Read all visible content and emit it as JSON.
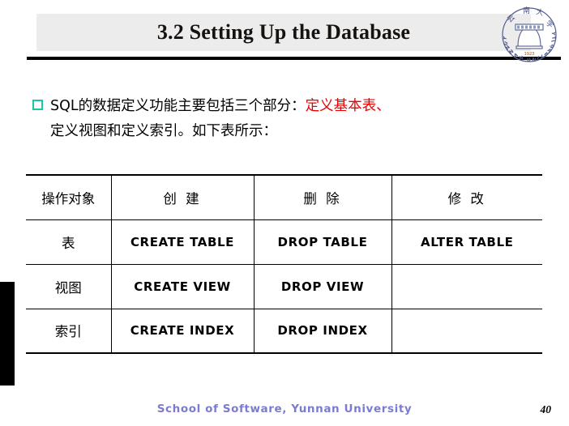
{
  "slide": {
    "title": "3.2 Setting Up the Database",
    "page_number": "40",
    "footer": "School of Software, Yunnan University",
    "colors": {
      "banner_background": "#ececec",
      "title_text": "#16120f",
      "rule": "#000000",
      "bullet_marker": "#17c8a0",
      "highlight_text": "#ef0000",
      "footer_text": "#7b7bd2",
      "left_tab": "#000000"
    }
  },
  "logo": {
    "name": "yunnan-university-emblem",
    "ring_top_text": "云 南 大 学",
    "ring_bottom_text": "YUNNAN UNIVERSITY",
    "year": "1923",
    "color": "#55608f"
  },
  "bullet": {
    "marker": "square-outline-bullet",
    "line1_prefix": "SQL的数据定义功能主要包括三个部分：",
    "line1_highlight": "定义基本表、",
    "line2": "定义视图和定义索引。如下表所示："
  },
  "table": {
    "headers": [
      "操作对象",
      "创 建",
      "删 除",
      "修 改"
    ],
    "rows": [
      [
        "表",
        "CREATE TABLE",
        "DROP TABLE",
        "ALTER TABLE"
      ],
      [
        "视图",
        "CREATE VIEW",
        "DROP VIEW",
        ""
      ],
      [
        "索引",
        "CREATE INDEX",
        "DROP INDEX",
        ""
      ]
    ]
  }
}
